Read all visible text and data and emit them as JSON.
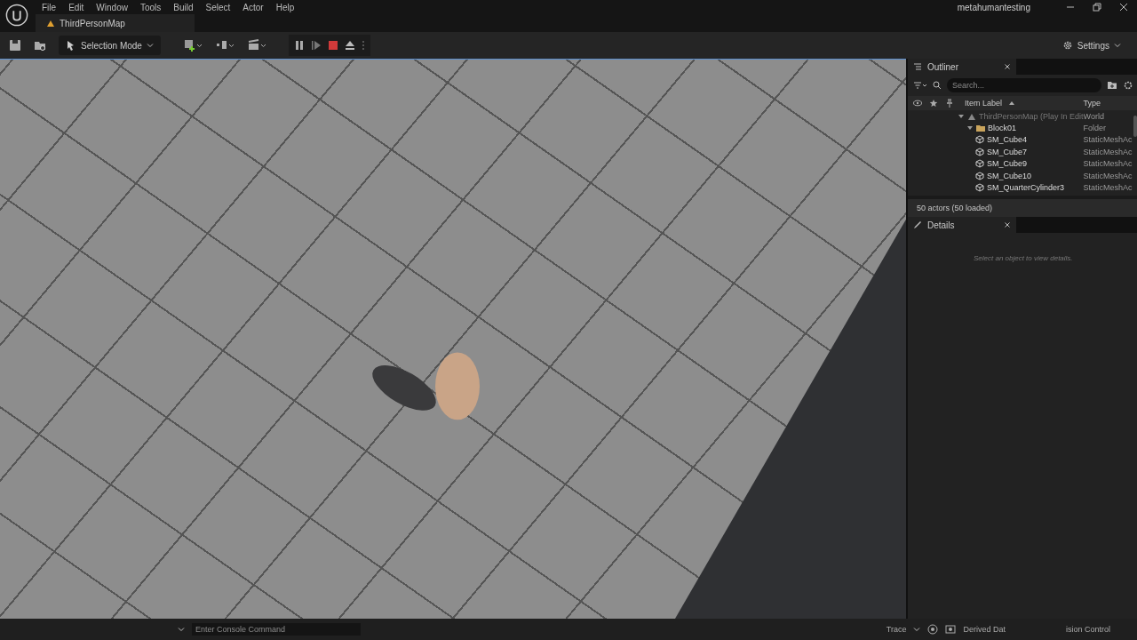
{
  "title_bar": {
    "menu": [
      "File",
      "Edit",
      "Window",
      "Tools",
      "Build",
      "Select",
      "Actor",
      "Help"
    ],
    "map_tab": "ThirdPersonMap",
    "project": "metahumantesting"
  },
  "toolbar": {
    "mode": "Selection Mode",
    "settings": "Settings"
  },
  "outliner": {
    "title": "Outliner",
    "search": {
      "placeholder": "Search..."
    },
    "columns": [
      "Item Label",
      "Type"
    ],
    "tree": [
      {
        "label": "ThirdPersonMap (Play In Edit",
        "type": "World",
        "kind": "world",
        "expanded": true,
        "children": [
          {
            "label": "Block01",
            "type": "Folder",
            "kind": "folder",
            "expanded": true,
            "children": [
              {
                "label": "SM_Cube4",
                "type": "StaticMeshAc",
                "kind": "mesh"
              },
              {
                "label": "SM_Cube7",
                "type": "StaticMeshAc",
                "kind": "mesh"
              },
              {
                "label": "SM_Cube9",
                "type": "StaticMeshAc",
                "kind": "mesh"
              },
              {
                "label": "SM_Cube10",
                "type": "StaticMeshAc",
                "kind": "mesh"
              },
              {
                "label": "SM_QuarterCylinder3",
                "type": "StaticMeshAc",
                "kind": "mesh"
              }
            ]
          }
        ]
      }
    ],
    "count": "50 actors (50 loaded)"
  },
  "details": {
    "title": "Details",
    "hint": "Select an object to view details."
  },
  "status_bar": {
    "console": {
      "placeholder": "Enter Console Command"
    },
    "trace": "Trace",
    "derived_data": "Derived Dat",
    "source_control": "ision Control"
  }
}
